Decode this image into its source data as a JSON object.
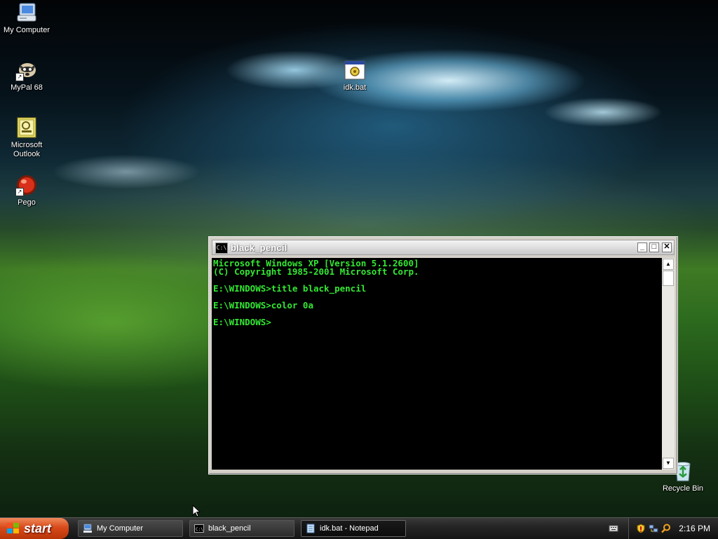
{
  "desktop": {
    "icons": [
      {
        "label": "My Computer"
      },
      {
        "label": "MyPal 68"
      },
      {
        "label": "Microsoft Outlook"
      },
      {
        "label": "Pego"
      },
      {
        "label": "idk.bat"
      },
      {
        "label": "Recycle Bin"
      }
    ]
  },
  "console": {
    "title": "black_pencil",
    "icon_text": "C:\\",
    "text_color": "#33e833",
    "lines": [
      "Microsoft Windows XP [Version 5.1.2600]",
      "(C) Copyright 1985-2001 Microsoft Corp.",
      "",
      "E:\\WINDOWS>title black_pencil",
      "",
      "E:\\WINDOWS>color 0a",
      "",
      "E:\\WINDOWS>"
    ]
  },
  "taskbar": {
    "start_label": "start",
    "buttons": [
      {
        "label": "My Computer",
        "icon": "computer-icon"
      },
      {
        "label": "black_pencil",
        "icon": "console-icon"
      },
      {
        "label": "idk.bat - Notepad",
        "icon": "notepad-icon",
        "active": true
      }
    ],
    "clock": "2:16 PM"
  }
}
